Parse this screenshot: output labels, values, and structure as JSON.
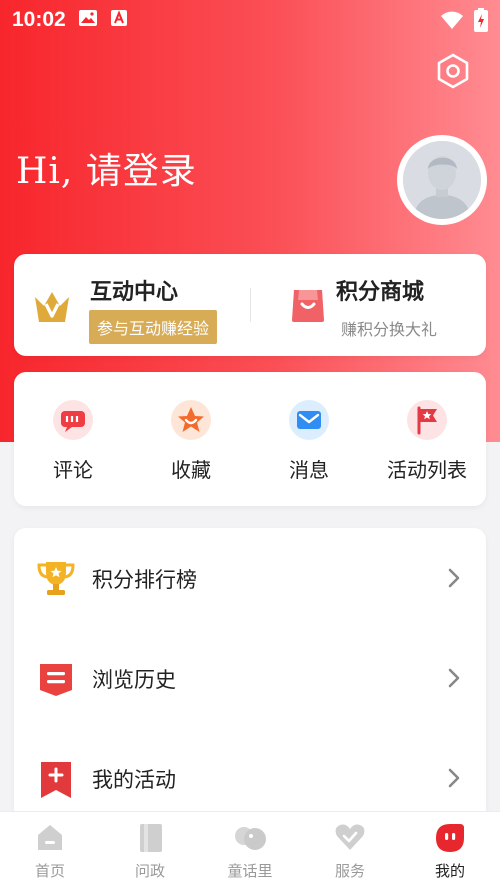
{
  "status_bar": {
    "time": "10:02"
  },
  "header": {
    "greeting": "Hi, 请登录"
  },
  "interaction": {
    "title": "互动中心",
    "badge": "参与互动赚经验"
  },
  "points_mall": {
    "title": "积分商城",
    "subtitle": "赚积分换大礼"
  },
  "quick_actions": [
    {
      "label": "评论",
      "icon": "comment-icon"
    },
    {
      "label": "收藏",
      "icon": "star-icon"
    },
    {
      "label": "消息",
      "icon": "mail-icon"
    },
    {
      "label": "活动列表",
      "icon": "flag-icon"
    }
  ],
  "menu": [
    {
      "label": "积分排行榜",
      "icon": "trophy-icon"
    },
    {
      "label": "浏览历史",
      "icon": "history-icon"
    },
    {
      "label": "我的活动",
      "icon": "activity-icon"
    }
  ],
  "tabs": [
    {
      "label": "首页",
      "icon": "home-icon"
    },
    {
      "label": "问政",
      "icon": "inquiry-icon"
    },
    {
      "label": "童话里",
      "icon": "fairytale-icon"
    },
    {
      "label": "服务",
      "icon": "service-icon"
    },
    {
      "label": "我的",
      "icon": "profile-icon",
      "active": true
    }
  ],
  "colors": {
    "brand_red": "#f7262c",
    "gold_badge": "#d8ac57"
  }
}
